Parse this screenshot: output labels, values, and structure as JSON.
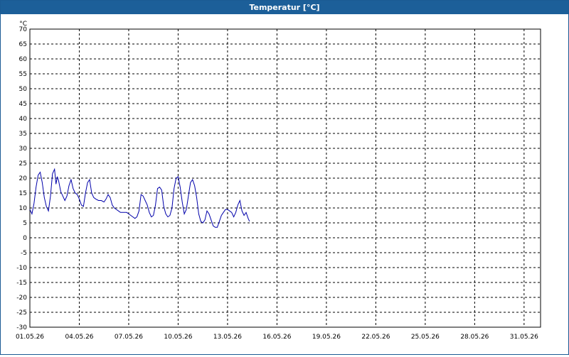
{
  "window": {
    "title": "Temperatur [°C]"
  },
  "chart_data": {
    "type": "line",
    "title": "Temperatur [°C]",
    "ylabel": "°C",
    "xlabel": "",
    "grid": true,
    "ylim": [
      -30,
      70
    ],
    "xlim": [
      "2026-05-01",
      "2026-06-01"
    ],
    "yticks": [
      70,
      65,
      60,
      55,
      50,
      45,
      40,
      35,
      30,
      25,
      20,
      15,
      10,
      5,
      0,
      -5,
      -10,
      -15,
      -20,
      -25,
      -30
    ],
    "xticks": [
      "01.05.26",
      "04.05.26",
      "07.05.26",
      "10.05.26",
      "13.05.26",
      "16.05.26",
      "19.05.26",
      "22.05.26",
      "25.05.26",
      "28.05.26",
      "31.05.26"
    ],
    "series": [
      {
        "color": "#0000aa",
        "points": [
          [
            "2026-05-01T00:00",
            9.5
          ],
          [
            "2026-05-01T03:00",
            8.0
          ],
          [
            "2026-05-01T06:00",
            11.5
          ],
          [
            "2026-05-01T09:00",
            17.0
          ],
          [
            "2026-05-01T12:00",
            21.0
          ],
          [
            "2026-05-01T15:00",
            22.0
          ],
          [
            "2026-05-01T18:00",
            18.5
          ],
          [
            "2026-05-01T21:00",
            13.5
          ],
          [
            "2026-05-02T00:00",
            10.5
          ],
          [
            "2026-05-02T03:00",
            9.0
          ],
          [
            "2026-05-02T06:00",
            14.0
          ],
          [
            "2026-05-02T09:00",
            21.5
          ],
          [
            "2026-05-02T12:00",
            23.0
          ],
          [
            "2026-05-02T14:00",
            18.0
          ],
          [
            "2026-05-02T16:00",
            20.5
          ],
          [
            "2026-05-02T18:00",
            19.0
          ],
          [
            "2026-05-02T21:00",
            15.5
          ],
          [
            "2026-05-03T00:00",
            14.0
          ],
          [
            "2026-05-03T03:00",
            12.5
          ],
          [
            "2026-05-03T06:00",
            14.0
          ],
          [
            "2026-05-03T09:00",
            17.5
          ],
          [
            "2026-05-03T12:00",
            19.5
          ],
          [
            "2026-05-03T15:00",
            16.5
          ],
          [
            "2026-05-03T18:00",
            15.0
          ],
          [
            "2026-05-03T21:00",
            14.5
          ],
          [
            "2026-05-04T00:00",
            13.0
          ],
          [
            "2026-05-04T03:00",
            11.0
          ],
          [
            "2026-05-04T06:00",
            10.5
          ],
          [
            "2026-05-04T09:00",
            15.0
          ],
          [
            "2026-05-04T12:00",
            18.5
          ],
          [
            "2026-05-04T15:00",
            19.5
          ],
          [
            "2026-05-04T18:00",
            15.0
          ],
          [
            "2026-05-04T21:00",
            13.5
          ],
          [
            "2026-05-05T00:00",
            13.0
          ],
          [
            "2026-05-05T04:00",
            12.5
          ],
          [
            "2026-05-05T08:00",
            12.5
          ],
          [
            "2026-05-05T12:00",
            12.0
          ],
          [
            "2026-05-05T15:00",
            13.0
          ],
          [
            "2026-05-05T18:00",
            14.5
          ],
          [
            "2026-05-05T21:00",
            13.5
          ],
          [
            "2026-05-06T00:00",
            11.0
          ],
          [
            "2026-05-06T03:00",
            10.0
          ],
          [
            "2026-05-06T06:00",
            9.5
          ],
          [
            "2026-05-06T09:00",
            9.0
          ],
          [
            "2026-05-06T12:00",
            8.5
          ],
          [
            "2026-05-06T15:00",
            8.5
          ],
          [
            "2026-05-06T18:00",
            8.5
          ],
          [
            "2026-05-06T21:00",
            8.5
          ],
          [
            "2026-05-07T00:00",
            8.0
          ],
          [
            "2026-05-07T03:00",
            7.5
          ],
          [
            "2026-05-07T06:00",
            7.0
          ],
          [
            "2026-05-07T09:00",
            6.5
          ],
          [
            "2026-05-07T12:00",
            7.0
          ],
          [
            "2026-05-07T15:00",
            9.0
          ],
          [
            "2026-05-07T18:00",
            14.5
          ],
          [
            "2026-05-07T21:00",
            14.0
          ],
          [
            "2026-05-08T00:00",
            12.5
          ],
          [
            "2026-05-08T03:00",
            11.0
          ],
          [
            "2026-05-08T06:00",
            8.5
          ],
          [
            "2026-05-08T09:00",
            7.0
          ],
          [
            "2026-05-08T12:00",
            7.5
          ],
          [
            "2026-05-08T15:00",
            11.0
          ],
          [
            "2026-05-08T18:00",
            16.5
          ],
          [
            "2026-05-08T21:00",
            17.0
          ],
          [
            "2026-05-09T00:00",
            16.0
          ],
          [
            "2026-05-09T03:00",
            10.5
          ],
          [
            "2026-05-09T06:00",
            8.0
          ],
          [
            "2026-05-09T09:00",
            7.0
          ],
          [
            "2026-05-09T12:00",
            7.5
          ],
          [
            "2026-05-09T15:00",
            10.0
          ],
          [
            "2026-05-09T18:00",
            16.5
          ],
          [
            "2026-05-09T21:00",
            20.0
          ],
          [
            "2026-05-10T00:00",
            20.5
          ],
          [
            "2026-05-10T03:00",
            17.0
          ],
          [
            "2026-05-10T06:00",
            12.0
          ],
          [
            "2026-05-10T09:00",
            8.0
          ],
          [
            "2026-05-10T12:00",
            9.5
          ],
          [
            "2026-05-10T15:00",
            14.0
          ],
          [
            "2026-05-10T18:00",
            18.5
          ],
          [
            "2026-05-10T21:00",
            19.5
          ],
          [
            "2026-05-11T00:00",
            17.5
          ],
          [
            "2026-05-11T03:00",
            13.5
          ],
          [
            "2026-05-11T06:00",
            8.0
          ],
          [
            "2026-05-11T09:00",
            5.5
          ],
          [
            "2026-05-11T12:00",
            5.0
          ],
          [
            "2026-05-11T15:00",
            6.0
          ],
          [
            "2026-05-11T18:00",
            9.0
          ],
          [
            "2026-05-11T21:00",
            8.0
          ],
          [
            "2026-05-12T00:00",
            6.0
          ],
          [
            "2026-05-12T03:00",
            4.0
          ],
          [
            "2026-05-12T06:00",
            3.5
          ],
          [
            "2026-05-12T09:00",
            3.5
          ],
          [
            "2026-05-12T12:00",
            5.5
          ],
          [
            "2026-05-12T15:00",
            7.5
          ],
          [
            "2026-05-12T18:00",
            8.5
          ],
          [
            "2026-05-12T21:00",
            9.5
          ],
          [
            "2026-05-13T00:00",
            9.5
          ],
          [
            "2026-05-13T03:00",
            9.0
          ],
          [
            "2026-05-13T06:00",
            8.5
          ],
          [
            "2026-05-13T09:00",
            7.0
          ],
          [
            "2026-05-13T12:00",
            8.5
          ],
          [
            "2026-05-13T15:00",
            11.0
          ],
          [
            "2026-05-13T18:00",
            12.5
          ],
          [
            "2026-05-13T21:00",
            9.0
          ],
          [
            "2026-05-14T00:00",
            7.5
          ],
          [
            "2026-05-14T03:00",
            8.5
          ],
          [
            "2026-05-14T06:00",
            6.5
          ],
          [
            "2026-05-14T08:00",
            5.5
          ]
        ]
      }
    ]
  }
}
